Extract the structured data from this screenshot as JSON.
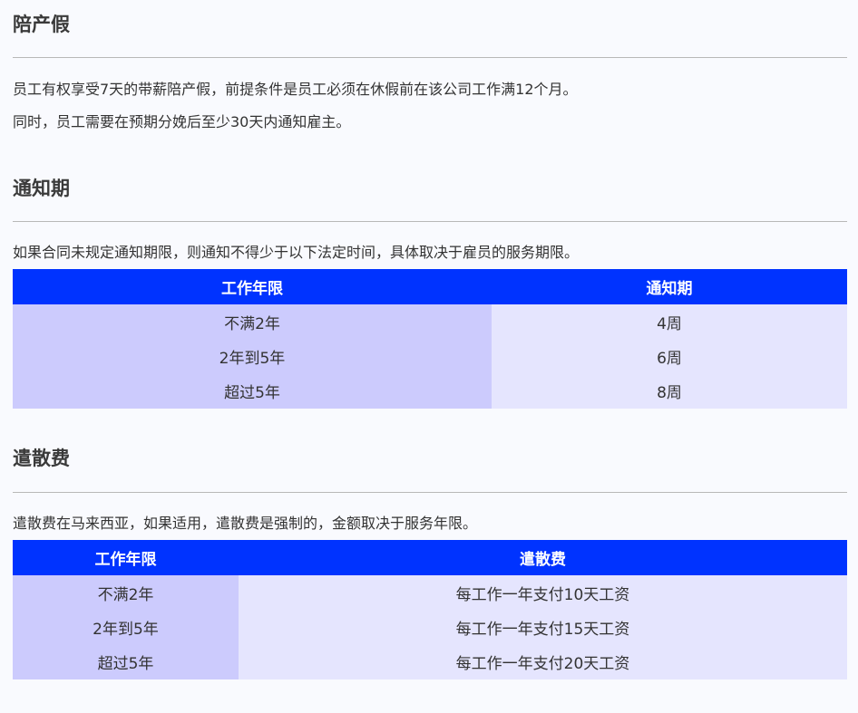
{
  "sections": {
    "paternity": {
      "title": "陪产假",
      "lines": [
        "员工有权享受7天的带薪陪产假，前提条件是员工必须在休假前在该公司工作满12个月。",
        "同时，员工需要在预期分娩后至少30天内通知雇主。"
      ]
    },
    "notice": {
      "title": "通知期",
      "intro": "如果合同未规定通知期限，则通知不得少于以下法定时间，具体取决于雇员的服务期限。",
      "table": {
        "headers": [
          "工作年限",
          "通知期"
        ],
        "rows": [
          [
            "不满2年",
            "4周"
          ],
          [
            "2年到5年",
            "6周"
          ],
          [
            "超过5年",
            "8周"
          ]
        ]
      }
    },
    "severance": {
      "title": "遣散费",
      "intro": "遣散费在马来西亚，如果适用，遣散费是强制的，金额取决于服务年限。",
      "table": {
        "headers": [
          "工作年限",
          "遣散费"
        ],
        "rows": [
          [
            "不满2年",
            "每工作一年支付10天工资"
          ],
          [
            "2年到5年",
            "每工作一年支付15天工资"
          ],
          [
            "超过5年",
            "每工作一年支付20天工资"
          ]
        ]
      }
    }
  }
}
